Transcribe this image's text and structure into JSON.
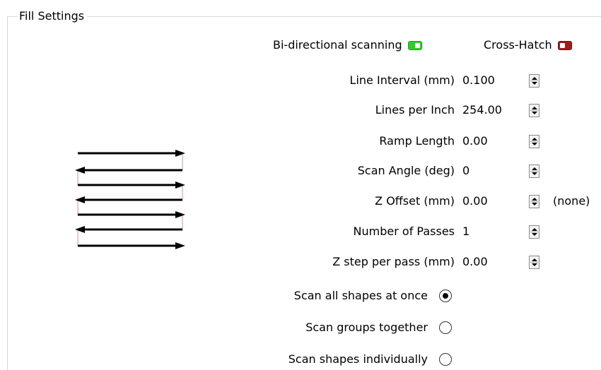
{
  "group": {
    "title": "Fill Settings"
  },
  "toggles": {
    "bidirectional": {
      "label": "Bi-directional scanning",
      "state": "on"
    },
    "crosshatch": {
      "label": "Cross-Hatch",
      "state": "off"
    }
  },
  "fields": [
    {
      "label": "Line Interval (mm)",
      "value": "0.100",
      "suffix": ""
    },
    {
      "label": "Lines per Inch",
      "value": "254.00",
      "suffix": ""
    },
    {
      "label": "Ramp Length",
      "value": "0.00",
      "suffix": ""
    },
    {
      "label": "Scan Angle (deg)",
      "value": "0",
      "suffix": ""
    },
    {
      "label": "Z Offset (mm)",
      "value": "0.00",
      "suffix": "(none)"
    },
    {
      "label": "Number of Passes",
      "value": "1",
      "suffix": ""
    },
    {
      "label": "Z step per pass (mm)",
      "value": "0.00",
      "suffix": ""
    }
  ],
  "radios": [
    {
      "label": "Scan all shapes at once",
      "checked": true
    },
    {
      "label": "Scan groups together",
      "checked": false
    },
    {
      "label": "Scan shapes individually",
      "checked": false
    }
  ],
  "colors": {
    "toggle_on": "#2ecc2e",
    "toggle_off": "#a31a1a",
    "scan_line": "#000000",
    "link_line": "#f0a0a0"
  },
  "icons": {
    "illustration": "bidirectional-scan-arrows-icon",
    "spinner": "spinner-arrows-icon"
  }
}
